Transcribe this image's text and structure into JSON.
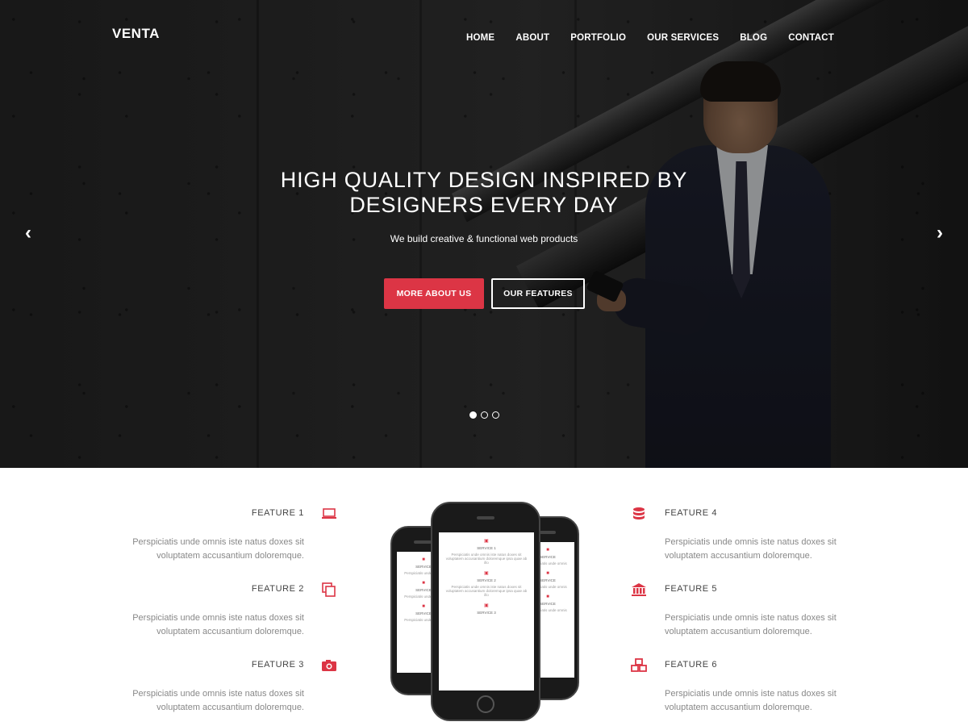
{
  "brand": {
    "logo": "VENTA",
    "accent": "#dc3545"
  },
  "nav": {
    "items": [
      "HOME",
      "ABOUT",
      "PORTFOLIO",
      "OUR SERVICES",
      "BLOG",
      "CONTACT"
    ]
  },
  "hero": {
    "title_line1": "HIGH QUALITY DESIGN INSPIRED BY",
    "title_line2": "DESIGNERS EVERY DAY",
    "subtitle": "We build creative & functional web products",
    "primary_button": "MORE ABOUT US",
    "secondary_button": "OUR FEATURES",
    "prev_icon": "chevron-left-icon",
    "next_icon": "chevron-right-icon",
    "slides_total": 3,
    "active_slide": 1
  },
  "features": {
    "left": [
      {
        "title": "FEATURE 1",
        "icon": "laptop-icon",
        "desc_line1": "Perspiciatis unde omnis iste natus doxes sit",
        "desc_line2": "voluptatem accusantium doloremque."
      },
      {
        "title": "FEATURE 2",
        "icon": "copy-icon",
        "desc_line1": "Perspiciatis unde omnis iste natus doxes sit",
        "desc_line2": "voluptatem accusantium doloremque."
      },
      {
        "title": "FEATURE 3",
        "icon": "camera-icon",
        "desc_line1": "Perspiciatis unde omnis iste natus doxes sit",
        "desc_line2": "voluptatem accusantium doloremque."
      }
    ],
    "right": [
      {
        "title": "FEATURE 4",
        "icon": "database-icon",
        "desc_line1": "Perspiciatis unde omnis iste natus doxes sit",
        "desc_line2": "voluptatem accusantium doloremque."
      },
      {
        "title": "FEATURE 5",
        "icon": "bank-icon",
        "desc_line1": "Perspiciatis unde omnis iste natus doxes sit",
        "desc_line2": "voluptatem accusantium doloremque."
      },
      {
        "title": "FEATURE 6",
        "icon": "cubes-icon",
        "desc_line1": "Perspiciatis unde omnis iste natus doxes sit",
        "desc_line2": "voluptatem accusantium doloremque."
      }
    ]
  },
  "phone_mockup": {
    "services": [
      {
        "title": "SERVICE 1",
        "text": "Perspiciatis unde omnis iste natus doxes sit voluptatem accusantium doloremque ipsa quae ab illo"
      },
      {
        "title": "SERVICE 2",
        "text": "Perspiciatis unde omnis iste natus doxes sit voluptatem accusantium doloremque ipsa quae ab illo"
      },
      {
        "title": "SERVICE 3",
        "text": ""
      }
    ]
  }
}
